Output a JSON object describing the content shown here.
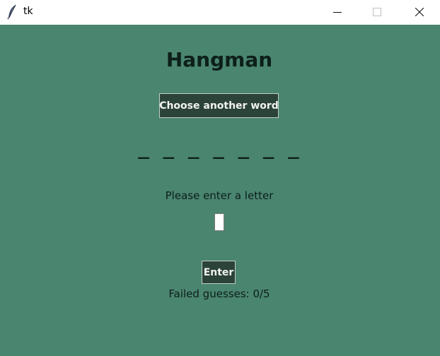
{
  "window": {
    "title": "tk",
    "app_icon": "feather-icon",
    "controls": {
      "minimize_icon": "minimize-icon",
      "maximize_icon": "maximize-icon",
      "close_icon": "close-icon"
    }
  },
  "game": {
    "heading": "Hangman",
    "choose_button_label": "Choose another word",
    "word_mask": "_ _ _ _ _ _ _",
    "prompt": "Please enter a letter",
    "letter_input_value": "",
    "enter_button_label": "Enter",
    "failed_guesses": "Failed guesses: 0/5"
  },
  "colors": {
    "background": "#4a8570",
    "button_bg": "#2b4339",
    "button_text": "#f2f2f2",
    "text": "#0d1f19"
  }
}
